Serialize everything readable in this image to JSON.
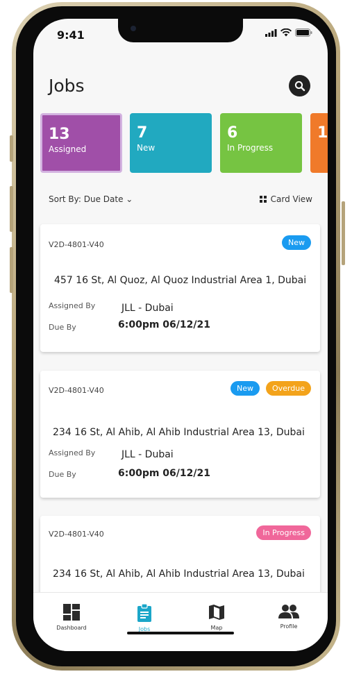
{
  "status_bar": {
    "time": "9:41"
  },
  "header": {
    "title": "Jobs"
  },
  "stats": [
    {
      "count": "13",
      "label": "Assigned",
      "color": "#a04fa8"
    },
    {
      "count": "7",
      "label": "New",
      "color": "#21a9c0"
    },
    {
      "count": "6",
      "label": "In Progress",
      "color": "#76c442"
    },
    {
      "count": "1",
      "label": "",
      "color": "#f07a2a"
    }
  ],
  "sort": {
    "label": "Sort By: Due Date",
    "view_label": "Card View"
  },
  "jobs": [
    {
      "id": "V2D-4801-V40",
      "badges": [
        "New"
      ],
      "address": "457 16 St, Al Quoz, Al Quoz Industrial Area 1, Dubai",
      "assigned_by_label": "Assigned By",
      "assigned_by": "JLL -  Dubai",
      "due_by_label": "Due By",
      "due_by": "6:00pm 06/12/21"
    },
    {
      "id": "V2D-4801-V40",
      "badges": [
        "New",
        "Overdue"
      ],
      "address": "234 16 St, Al Ahib, Al Ahib  Industrial Area 13, Dubai",
      "assigned_by_label": "Assigned By",
      "assigned_by": "JLL -  Dubai",
      "due_by_label": "Due By",
      "due_by": "6:00pm 06/12/21"
    },
    {
      "id": "V2D-4801-V40",
      "badges": [
        "In Progress"
      ],
      "address": "234 16 St, Al Ahib, Al Ahib  Industrial Area 13, Dubai"
    }
  ],
  "badge_colors": {
    "new": "#1a9bf0",
    "overdue": "#f3a31b",
    "in_progress": "#f0679a"
  },
  "tabs": [
    {
      "label": "Dashboard",
      "icon": "dashboard-icon"
    },
    {
      "label": "Jobs",
      "icon": "clipboard-icon",
      "active": true
    },
    {
      "label": "Map",
      "icon": "map-icon"
    },
    {
      "label": "Profile",
      "icon": "people-icon"
    }
  ],
  "accent_color": "#1ba6c9"
}
